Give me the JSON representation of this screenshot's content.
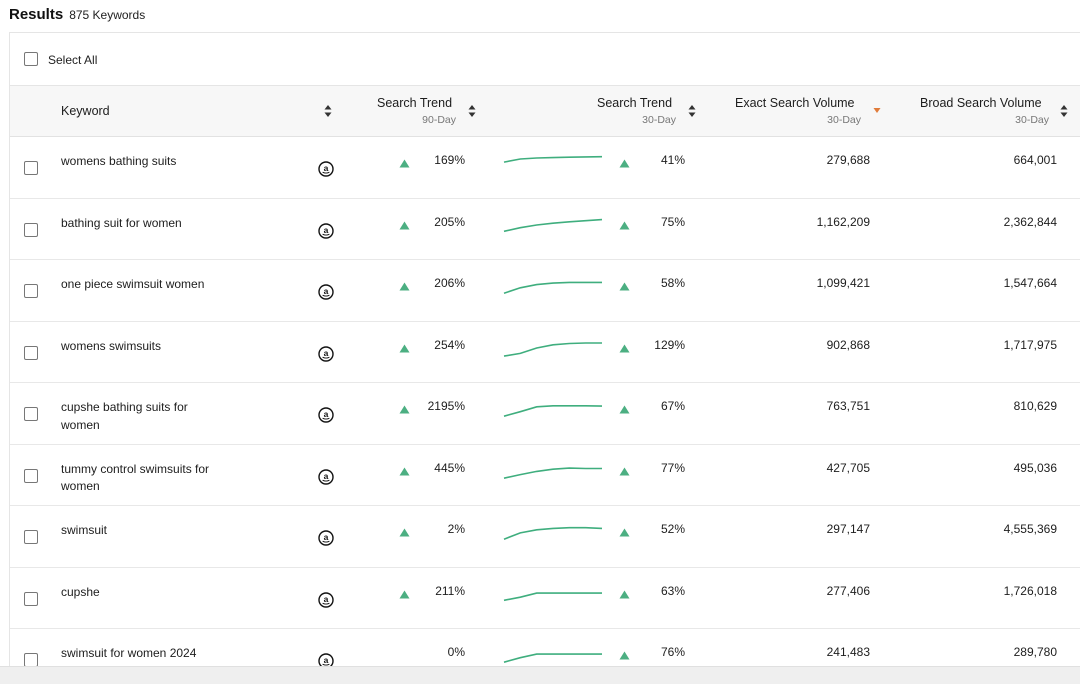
{
  "header": {
    "title": "Results",
    "count": "875 Keywords"
  },
  "select_all": {
    "label": "Select All"
  },
  "columns": {
    "keyword": {
      "label": "Keyword"
    },
    "trend90": {
      "label": "Search Trend",
      "sub": "90-Day"
    },
    "trend30": {
      "label": "Search Trend",
      "sub": "30-Day"
    },
    "exact": {
      "label": "Exact Search Volume",
      "sub": "30-Day"
    },
    "broad": {
      "label": "Broad Search Volume",
      "sub": "30-Day"
    }
  },
  "colors": {
    "up_arrow": "#4caf82",
    "sort_active": "#e07b3a",
    "sparkline": "#3fae7e"
  },
  "icons": {
    "marketplace": "amazon-icon",
    "trend_up": "triangle-up-icon",
    "sort": "sort-icon"
  },
  "rows": [
    {
      "keyword": "womens bathing suits",
      "trend90": "169%",
      "trend90_up": true,
      "trend30": "41%",
      "spark": [
        0.55,
        0.72,
        0.78,
        0.8,
        0.82,
        0.84,
        0.85
      ],
      "exact": "279,688",
      "broad": "664,001"
    },
    {
      "keyword": "bathing suit for women",
      "trend90": "205%",
      "trend90_up": true,
      "trend30": "75%",
      "spark": [
        0.15,
        0.35,
        0.5,
        0.6,
        0.68,
        0.74,
        0.8
      ],
      "exact": "1,162,209",
      "broad": "2,362,844"
    },
    {
      "keyword": "one piece swimsuit women",
      "trend90": "206%",
      "trend90_up": true,
      "trend30": "58%",
      "spark": [
        0.1,
        0.4,
        0.58,
        0.66,
        0.7,
        0.7,
        0.7
      ],
      "exact": "1,099,421",
      "broad": "1,547,664"
    },
    {
      "keyword": "womens swimsuits",
      "trend90": "254%",
      "trend90_up": true,
      "trend30": "129%",
      "spark": [
        0.05,
        0.2,
        0.5,
        0.68,
        0.75,
        0.78,
        0.78
      ],
      "exact": "902,868",
      "broad": "1,717,975"
    },
    {
      "keyword": "cupshe bathing suits for women",
      "trend90": "2195%",
      "trend90_up": true,
      "trend30": "67%",
      "spark": [
        0.1,
        0.35,
        0.62,
        0.68,
        0.68,
        0.68,
        0.66
      ],
      "exact": "763,751",
      "broad": "810,629"
    },
    {
      "keyword": "tummy control swimsuits for women",
      "trend90": "445%",
      "trend90_up": true,
      "trend30": "77%",
      "spark": [
        0.1,
        0.3,
        0.48,
        0.6,
        0.66,
        0.64,
        0.64
      ],
      "exact": "427,705",
      "broad": "495,036"
    },
    {
      "keyword": "swimsuit",
      "trend90": "2%",
      "trend90_up": true,
      "trend30": "52%",
      "spark": [
        0.1,
        0.45,
        0.62,
        0.7,
        0.74,
        0.74,
        0.7
      ],
      "exact": "297,147",
      "broad": "4,555,369"
    },
    {
      "keyword": "cupshe",
      "trend90": "211%",
      "trend90_up": true,
      "trend30": "63%",
      "spark": [
        0.15,
        0.32,
        0.55,
        0.55,
        0.55,
        0.55,
        0.55
      ],
      "exact": "277,406",
      "broad": "1,726,018"
    },
    {
      "keyword": "swimsuit for women 2024",
      "trend90": "0%",
      "trend90_up": false,
      "trend30": "76%",
      "spark": [
        0.1,
        0.35,
        0.55,
        0.55,
        0.55,
        0.55,
        0.55
      ],
      "exact": "241,483",
      "broad": "289,780"
    }
  ]
}
